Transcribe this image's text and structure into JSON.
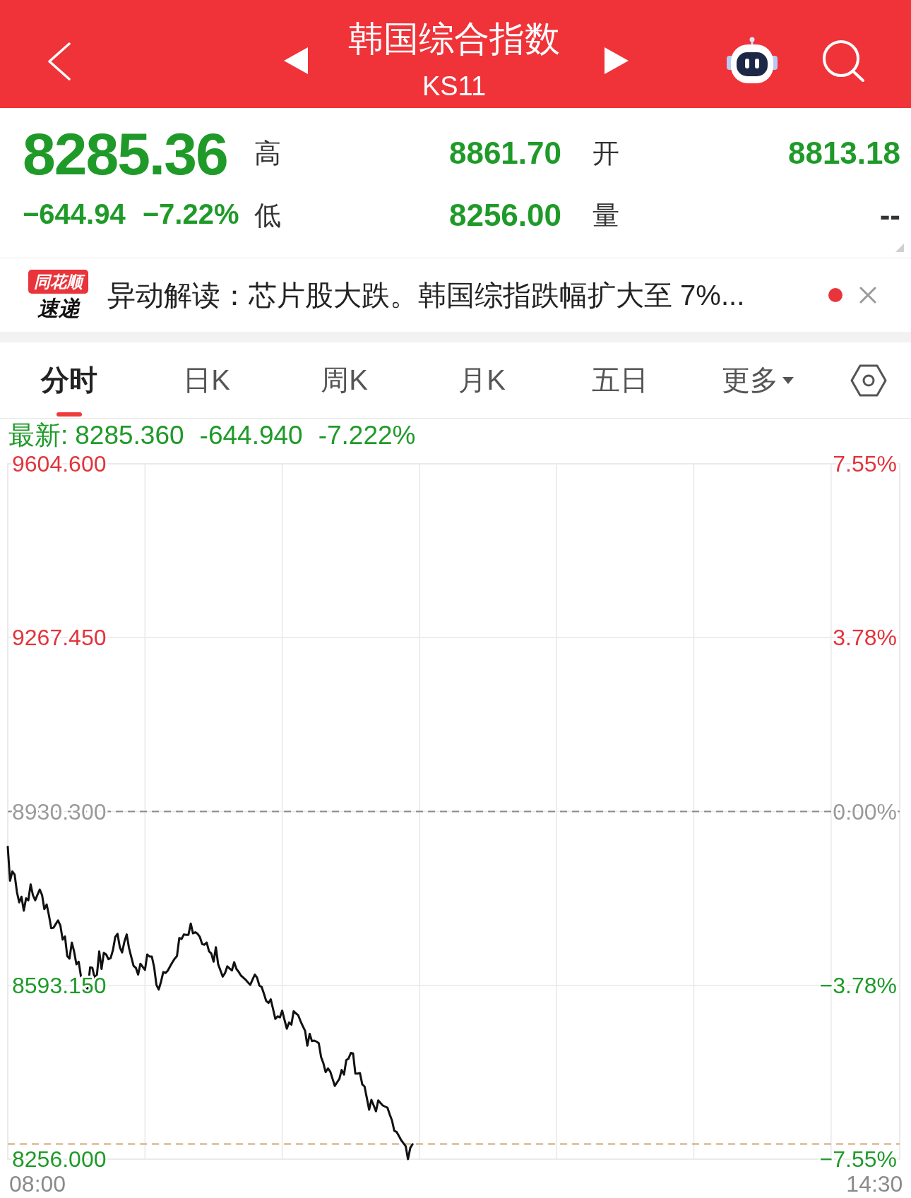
{
  "header": {
    "title": "韩国综合指数",
    "code": "KS11"
  },
  "quote": {
    "price": "8285.36",
    "change": "−644.94",
    "change_percent": "−7.22%",
    "falling": true,
    "stats": [
      {
        "label": "高",
        "value": "8861.70",
        "falling": true
      },
      {
        "label": "开",
        "value": "8813.18",
        "falling": true
      },
      {
        "label": "低",
        "value": "8256.00",
        "falling": true
      },
      {
        "label": "量",
        "value": "--",
        "falling": false
      }
    ]
  },
  "news": {
    "badge_top": "同花顺",
    "badge_bottom": "速递",
    "text": "异动解读：芯片股大跌。韩国综指跌幅扩大至 7%...",
    "unread": true
  },
  "tabs": [
    {
      "label": "分时",
      "selected": true,
      "kind": "tab"
    },
    {
      "label": "日K",
      "selected": false,
      "kind": "tab"
    },
    {
      "label": "周K",
      "selected": false,
      "kind": "tab"
    },
    {
      "label": "月K",
      "selected": false,
      "kind": "tab"
    },
    {
      "label": "五日",
      "selected": false,
      "kind": "tab"
    },
    {
      "label": "更多",
      "selected": false,
      "kind": "dropdown"
    }
  ],
  "chart": {
    "latest": {
      "label": "最新:",
      "price": "8285.360",
      "change": "-644.940",
      "percent": "-7.222%",
      "falling": true
    },
    "percent_labels": [
      "7.55%",
      "3.78%",
      "0.00%",
      "−3.78%",
      "−7.55%"
    ],
    "chart_data": {
      "type": "line",
      "grid": true,
      "categories": [
        null,
        null,
        null,
        null,
        null,
        null,
        null,
        null,
        null,
        null,
        null,
        null,
        null,
        "08:00",
        null,
        null,
        null,
        null,
        null,
        null,
        null,
        null,
        null,
        null,
        null,
        null,
        null,
        null,
        null,
        null,
        null,
        null,
        null,
        null,
        null,
        null,
        null,
        null,
        null,
        null,
        null,
        null,
        null,
        null,
        null,
        null,
        null,
        null,
        null,
        null,
        null,
        null,
        null,
        null,
        null,
        null,
        null,
        null,
        null,
        null,
        null,
        null,
        null,
        null,
        null,
        null,
        null,
        null,
        null,
        null,
        null,
        null,
        null,
        null,
        null,
        null,
        null,
        null,
        null,
        null,
        null,
        null,
        null,
        null,
        null,
        null,
        null,
        null,
        null,
        null,
        null,
        null,
        null,
        null,
        null,
        null,
        null,
        null,
        null,
        null,
        null,
        null,
        null,
        null,
        null,
        null,
        null,
        null,
        null,
        null,
        null,
        null,
        null,
        null,
        null,
        null,
        null,
        null,
        null,
        null,
        null,
        null,
        null,
        null,
        null,
        null,
        null,
        null,
        null,
        null,
        null,
        null,
        null,
        null,
        null,
        null,
        null,
        null,
        null,
        null,
        null,
        null,
        null,
        null,
        null,
        null,
        null,
        null,
        null,
        null,
        null,
        null,
        null,
        null,
        null,
        null,
        null,
        null,
        null,
        null,
        null,
        null,
        null,
        null,
        null,
        null,
        null,
        null,
        null,
        null,
        null,
        null,
        null,
        null,
        null,
        null,
        null,
        null,
        null,
        null,
        null,
        null,
        null,
        null,
        null,
        null,
        null,
        null,
        null,
        null,
        null,
        null,
        null,
        null,
        null,
        null,
        null,
        null,
        null,
        null,
        null,
        null,
        null,
        null,
        null,
        null,
        null,
        null,
        null,
        null,
        null,
        null,
        null,
        null,
        null,
        null,
        null,
        null,
        null,
        null,
        null,
        null,
        null,
        null,
        null,
        null,
        null,
        null,
        null,
        null,
        null,
        null,
        null,
        null,
        null,
        null,
        null,
        null,
        null,
        null,
        null,
        null,
        null,
        null,
        null,
        null,
        null,
        null,
        null,
        null,
        null,
        null,
        null,
        null,
        null,
        null,
        null,
        null,
        null,
        null,
        null,
        null,
        null,
        null,
        null,
        null,
        null,
        null,
        null,
        null,
        null,
        null,
        null,
        null,
        null,
        null,
        null,
        null,
        null,
        null,
        null,
        null,
        null,
        null,
        null,
        null,
        null,
        null,
        null,
        null,
        null,
        null,
        null,
        null,
        null,
        null,
        null,
        null,
        null,
        null,
        null,
        null,
        null,
        null,
        null,
        null,
        null,
        null,
        null,
        null,
        null,
        null,
        null,
        null,
        null,
        null,
        null,
        null,
        null,
        null,
        null,
        null,
        null,
        null,
        null,
        null,
        null,
        null,
        null,
        null,
        null,
        null,
        null,
        null,
        null,
        null,
        null,
        null,
        null,
        null,
        null,
        null,
        null,
        null,
        null,
        null,
        null,
        null,
        null,
        null,
        null,
        null,
        null,
        null,
        null,
        null,
        null,
        null,
        null,
        null,
        null,
        null,
        null,
        null,
        null,
        null,
        null,
        null,
        null,
        null,
        null,
        null,
        null,
        null,
        null,
        null,
        null,
        null,
        null,
        "14:30",
        null,
        null,
        null,
        null,
        null,
        null,
        null,
        null,
        null,
        null,
        null
      ],
      "series": [
        {
          "color": "#111111",
          "values": [
            8862,
            8796,
            8814,
            8808,
            8774,
            8754,
            8765,
            8738,
            8762,
            8758,
            8789,
            8768,
            8758,
            8769,
            8779,
            8768,
            8741,
            8750,
            8729,
            8704,
            8705,
            8712,
            8719,
            8709,
            8682,
            8688,
            8650,
            8645,
            8676,
            8659,
            8634,
            8639,
            8611,
            8608,
            8586,
            8586,
            8628,
            8627,
            8607,
            8614,
            8659,
            8625,
            8656,
            8653,
            8644,
            8646,
            8662,
            8687,
            8693,
            8667,
            8657,
            8678,
            8692,
            8666,
            8648,
            8631,
            8627,
            8614,
            8635,
            8629,
            8623,
            8653,
            8649,
            8649,
            8628,
            8594,
            8585,
            8600,
            8619,
            8617,
            8622,
            8630,
            8638,
            8645,
            8650,
            8685,
            8683,
            8692,
            8691,
            8691,
            8713,
            8694,
            8696,
            8693,
            8687,
            8673,
            8672,
            8676,
            8659,
            8655,
            8639,
            8667,
            8634,
            8622,
            8610,
            8617,
            8630,
            8626,
            8622,
            8638,
            8625,
            8619,
            8612,
            8608,
            8604,
            8599,
            8594,
            8604,
            8614,
            8608,
            8593,
            8590,
            8577,
            8563,
            8559,
            8566,
            8547,
            8528,
            8533,
            8531,
            8544,
            8526,
            8509,
            8521,
            8517,
            8543,
            8539,
            8535,
            8524,
            8514,
            8505,
            8476,
            8499,
            8485,
            8486,
            8484,
            8481,
            8454,
            8442,
            8425,
            8432,
            8426,
            8412,
            8398,
            8405,
            8412,
            8429,
            8420,
            8448,
            8451,
            8462,
            8461,
            8422,
            8422,
            8423,
            8401,
            8397,
            8375,
            8352,
            8371,
            8360,
            8349,
            8370,
            8365,
            8360,
            8358,
            8356,
            8343,
            8331,
            8311,
            8309,
            8301,
            8293,
            8287,
            8281,
            8256,
            8278,
            8285,
            null,
            null,
            null,
            null,
            null,
            null,
            null,
            null,
            null,
            null,
            null,
            null,
            null,
            null,
            null,
            null,
            null,
            null,
            null,
            null,
            null,
            null,
            null,
            null,
            null,
            null,
            null,
            null,
            null,
            null,
            null,
            null,
            null,
            null,
            null,
            null,
            null,
            null,
            null,
            null,
            null,
            null,
            null,
            null,
            null,
            null,
            null,
            null,
            null,
            null,
            null,
            null,
            null,
            null,
            null,
            null,
            null,
            null,
            null,
            null,
            null,
            null,
            null,
            null,
            null,
            null,
            null,
            null,
            null,
            null,
            null,
            null,
            null,
            null,
            null,
            null,
            null,
            null,
            null,
            null,
            null,
            null,
            null,
            null,
            null,
            null,
            null,
            null,
            null,
            null,
            null,
            null,
            null,
            null,
            null,
            null,
            null,
            null,
            null,
            null,
            null,
            null,
            null,
            null,
            null,
            null,
            null,
            null,
            null,
            null,
            null,
            null,
            null,
            null,
            null,
            null,
            null,
            null,
            null,
            null,
            null,
            null,
            null,
            null,
            null,
            null,
            null,
            null,
            null,
            null,
            null,
            null,
            null,
            null,
            null,
            null,
            null,
            null,
            null,
            null,
            null,
            null,
            null,
            null,
            null,
            null,
            null,
            null,
            null,
            null,
            null,
            null,
            null,
            null,
            null,
            null,
            null,
            null,
            null,
            null,
            null,
            null,
            null,
            null,
            null,
            null,
            null,
            null,
            null,
            null,
            null,
            null,
            null,
            null,
            null,
            null,
            null,
            null,
            null,
            null,
            null,
            null,
            null,
            null,
            null,
            null,
            null,
            null,
            null,
            null,
            null,
            null,
            null,
            null,
            null,
            null,
            null,
            null,
            null,
            null,
            null,
            null,
            null,
            null,
            null,
            null,
            null,
            null,
            null,
            null,
            null,
            null,
            null
          ]
        }
      ],
      "ylim": [
        8256,
        9604.6
      ],
      "yticks": [
        {
          "value": 9604.6,
          "label": "9604.600"
        },
        {
          "value": 9267.45,
          "label": "9267.450"
        },
        {
          "value": 8930.3,
          "label": "8930.300"
        },
        {
          "value": 8593.15,
          "label": "8593.150"
        },
        {
          "value": 8256,
          "label": "8256.000"
        }
      ],
      "ref_lines": [
        {
          "axis": "y",
          "value": 8930.3
        },
        {
          "axis": "y",
          "value": 8285.36
        }
      ]
    }
  }
}
